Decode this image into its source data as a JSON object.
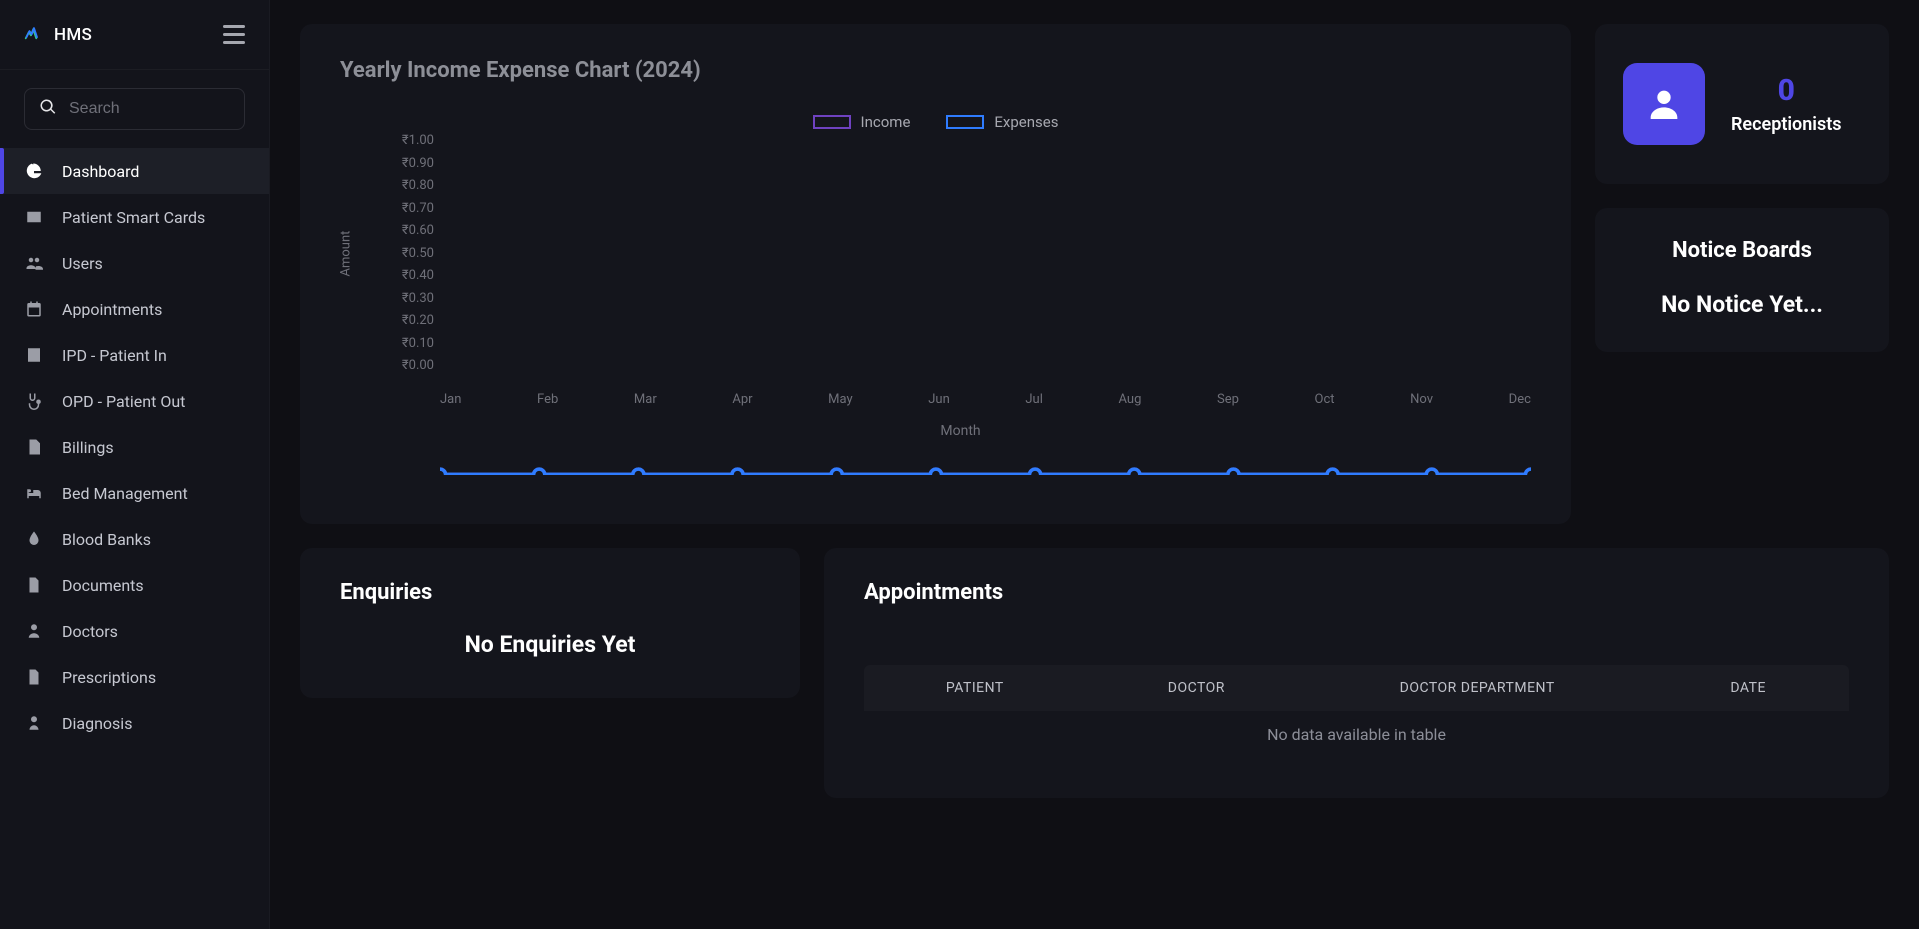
{
  "brand": {
    "name": "HMS"
  },
  "search": {
    "placeholder": "Search"
  },
  "sidebar": {
    "items": [
      {
        "label": "Dashboard"
      },
      {
        "label": "Patient Smart Cards"
      },
      {
        "label": "Users"
      },
      {
        "label": "Appointments"
      },
      {
        "label": "IPD - Patient In"
      },
      {
        "label": "OPD - Patient Out"
      },
      {
        "label": "Billings"
      },
      {
        "label": "Bed Management"
      },
      {
        "label": "Blood Banks"
      },
      {
        "label": "Documents"
      },
      {
        "label": "Doctors"
      },
      {
        "label": "Prescriptions"
      },
      {
        "label": "Diagnosis"
      }
    ]
  },
  "chart_data": {
    "type": "line",
    "title": "Yearly Income Expense Chart (2024)",
    "xlabel": "Month",
    "ylabel": "Amount",
    "categories": [
      "Jan",
      "Feb",
      "Mar",
      "Apr",
      "May",
      "Jun",
      "Jul",
      "Aug",
      "Sep",
      "Oct",
      "Nov",
      "Dec"
    ],
    "y_ticks": [
      "₹1.00",
      "₹0.90",
      "₹0.80",
      "₹0.70",
      "₹0.60",
      "₹0.50",
      "₹0.40",
      "₹0.30",
      "₹0.20",
      "₹0.10",
      "₹0.00"
    ],
    "ylim": [
      0,
      1.0
    ],
    "series": [
      {
        "name": "Income",
        "color": "#6f42c1",
        "values": [
          0,
          0,
          0,
          0,
          0,
          0,
          0,
          0,
          0,
          0,
          0,
          0
        ]
      },
      {
        "name": "Expenses",
        "color": "#2f7cff",
        "values": [
          0,
          0,
          0,
          0,
          0,
          0,
          0,
          0,
          0,
          0,
          0,
          0
        ]
      }
    ]
  },
  "stat": {
    "value": "0",
    "label": "Receptionists"
  },
  "notice": {
    "title": "Notice Boards",
    "empty": "No Notice Yet..."
  },
  "enquiries": {
    "title": "Enquiries",
    "empty": "No Enquiries Yet"
  },
  "appointments": {
    "title": "Appointments",
    "columns": {
      "patient": "PATIENT",
      "doctor": "DOCTOR",
      "dept": "DOCTOR DEPARTMENT",
      "date": "DATE"
    },
    "empty": "No data available in table"
  }
}
